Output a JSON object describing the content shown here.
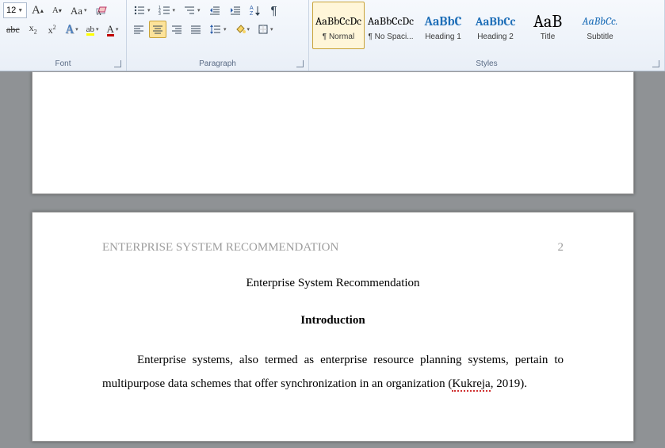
{
  "ribbon": {
    "font": {
      "size": "12",
      "grow_label": "A",
      "shrink_label": "A",
      "case_label": "Aa",
      "strike_label": "abc",
      "sub_label": "x",
      "sup_label": "x",
      "effects_label": "A",
      "highlight_label": "ab",
      "color_label": "A",
      "group_label": "Font"
    },
    "paragraph": {
      "group_label": "Paragraph"
    },
    "styles": {
      "group_label": "Styles",
      "items": [
        {
          "preview": "AaBbCcDc",
          "label": "¶ Normal",
          "cls": "",
          "selected": true
        },
        {
          "preview": "AaBbCcDc",
          "label": "¶ No Spaci...",
          "cls": "",
          "selected": false
        },
        {
          "preview": "AaBbC",
          "label": "Heading 1",
          "cls": "blue",
          "selected": false
        },
        {
          "preview": "AaBbCc",
          "label": "Heading 2",
          "cls": "blue",
          "selected": false
        },
        {
          "preview": "AaB",
          "label": "Title",
          "cls": "big",
          "selected": false
        },
        {
          "preview": "AaBbCc.",
          "label": "Subtitle",
          "cls": "italic",
          "selected": false
        }
      ]
    }
  },
  "document": {
    "header_running": "ENTERPRISE SYSTEM RECOMMENDATION",
    "page_number": "2",
    "title": "Enterprise System Recommendation",
    "section_heading": "Introduction",
    "body_pre": "Enterprise systems, also termed as enterprise resource planning systems, pertain to multipurpose data schemes that offer synchronization in an organization (",
    "citation_author": "Kukreja",
    "body_post": ", 2019)."
  }
}
